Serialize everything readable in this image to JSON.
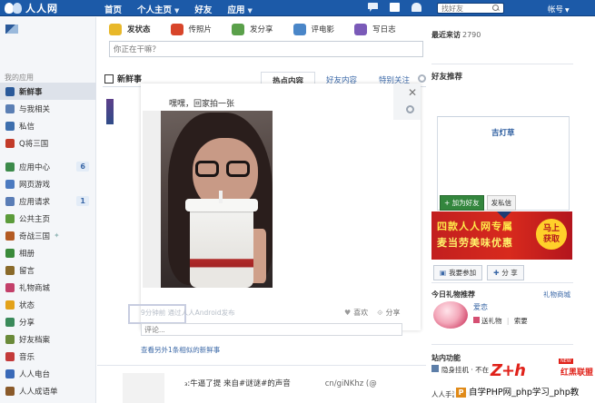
{
  "topbar": {
    "logo": "人人网",
    "nav": [
      {
        "label": "首页",
        "caret": false
      },
      {
        "label": "个人主页",
        "caret": true
      },
      {
        "label": "好友",
        "caret": false
      },
      {
        "label": "应用",
        "caret": true
      }
    ],
    "search_placeholder": "找好友",
    "account": "帐号"
  },
  "sidebar": {
    "section_title": "我的应用",
    "items": [
      {
        "label": "新鲜事",
        "color": "#2b5a9a",
        "active": true
      },
      {
        "label": "与我相关",
        "color": "#5b7fb4"
      },
      {
        "label": "私信",
        "color": "#3d6fae"
      },
      {
        "label": "Q将三国",
        "color": "#c23b2a"
      },
      {
        "label": "应用中心",
        "color": "#3c8a4a",
        "badge": "6"
      },
      {
        "label": "网页游戏",
        "color": "#4b7ac0"
      },
      {
        "label": "应用请求",
        "color": "#5a7db6",
        "badge": "1"
      },
      {
        "label": "公共主页",
        "color": "#5b9b3a"
      },
      {
        "label": "奇战三国",
        "color": "#b35a22",
        "extra": "✦"
      },
      {
        "label": "相册",
        "color": "#3a8a3a"
      },
      {
        "label": "留言",
        "color": "#8a6a2a"
      },
      {
        "label": "礼物商城",
        "color": "#c3406a"
      },
      {
        "label": "状态",
        "color": "#e3a21a"
      },
      {
        "label": "分享",
        "color": "#3a8a5a"
      },
      {
        "label": "好友档案",
        "color": "#6a8a3a"
      },
      {
        "label": "音乐",
        "color": "#c33a3a"
      },
      {
        "label": "人人电台",
        "color": "#3a6ab8"
      },
      {
        "label": "人人成语单",
        "color": "#8a5a2a"
      }
    ]
  },
  "publisher": {
    "tabs": [
      {
        "label": "发状态",
        "color": "#e8b82a"
      },
      {
        "label": "传照片",
        "color": "#d8452a"
      },
      {
        "label": "发分享",
        "color": "#5aa04a"
      },
      {
        "label": "评电影",
        "color": "#4a86c8"
      },
      {
        "label": "写日志",
        "color": "#7a5ab8"
      }
    ],
    "placeholder": "你正在干嘛？"
  },
  "feed": {
    "title": "新鲜事",
    "tabs": [
      "热点内容",
      "好友内容",
      "特别关注"
    ],
    "caption": "嘿嘿，回家拍一张",
    "meta": "9分钟前  通过人人Android发布",
    "actions": [
      "喜欢",
      "分享"
    ],
    "comment_placeholder": "评论...",
    "more_link": "查看另外1条相似的新鲜事",
    "next_text": "₃:牛逼了提 来自#谜谜#的声音",
    "next_link": "cn/giNKhz  (@"
  },
  "right": {
    "visits_label": "最近来访",
    "visits_count": "2790",
    "friend_title": "好友推荐",
    "friend_name": "吉灯草",
    "add_friend": "+ 加为好友",
    "send_msg": "发私信",
    "ad_line1": "四款人人网专属",
    "ad_line2": "麦当劳美味优惠",
    "ad_cta_1": "马上",
    "ad_cta_2": "获取",
    "ad_join": "我要参加",
    "ad_share": "分 享",
    "gift_title": "今日礼物推荐",
    "gift_link": "礼物商城",
    "gift_name": "爱恋",
    "gift_send": "送礼物",
    "gift_sep": "|",
    "gift_ask": "索要",
    "site_title": "站内功能",
    "site_line1": "隐身挂机 · 不在",
    "site_line2": "人人手游 · 加人 · 互动 · 游戏"
  },
  "watermark": {
    "brand": "Z+h",
    "tag": "红黑联盟",
    "new": "NEW",
    "p": "P",
    "line": "自学PHP网_php学习_php教"
  }
}
